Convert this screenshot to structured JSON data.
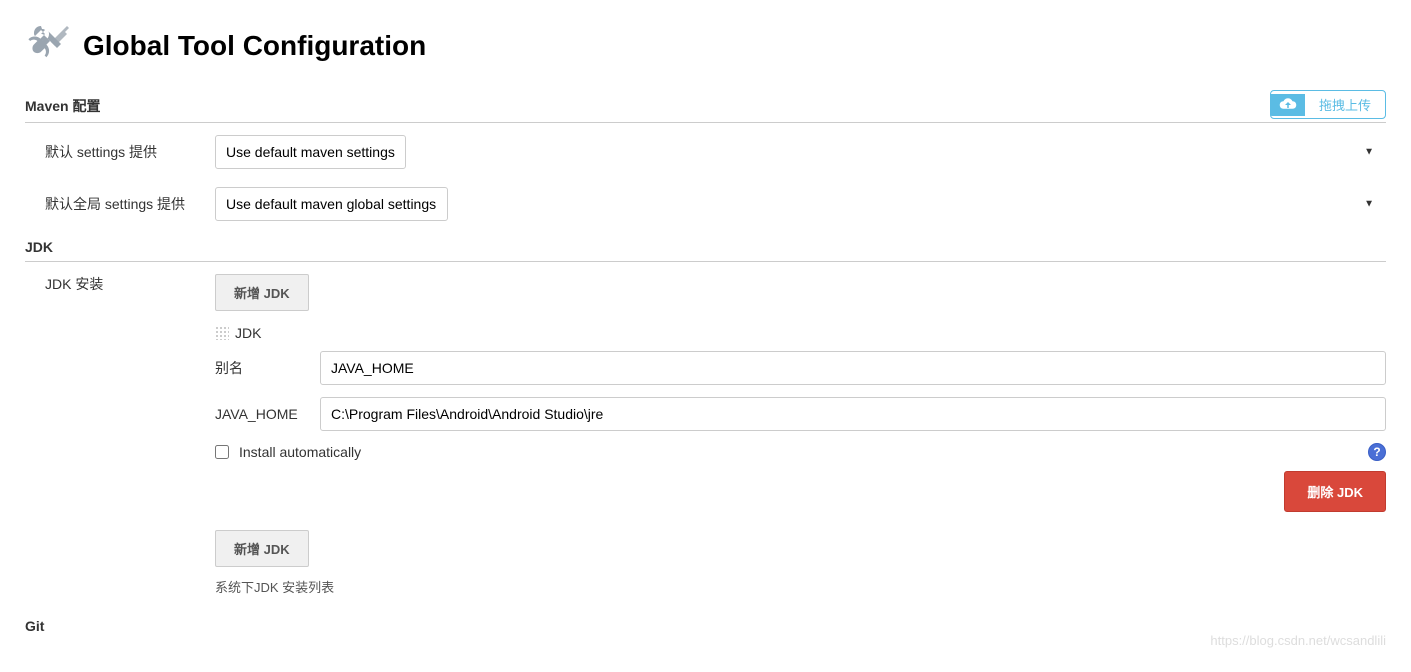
{
  "header": {
    "title": "Global Tool Configuration"
  },
  "upload_badge": {
    "text": "拖拽上传"
  },
  "maven": {
    "section_title": "Maven 配置",
    "settings_label": "默认 settings 提供",
    "settings_value": "Use default maven settings",
    "global_settings_label": "默认全局 settings 提供",
    "global_settings_value": "Use default maven global settings"
  },
  "jdk": {
    "section_title": "JDK",
    "install_label": "JDK 安装",
    "add_button": "新增 JDK",
    "block_title": "JDK",
    "alias_label": "别名",
    "alias_value": "JAVA_HOME",
    "home_label": "JAVA_HOME",
    "home_value": "C:\\Program Files\\Android\\Android Studio\\jre",
    "install_auto_label": "Install automatically",
    "install_auto_checked": false,
    "delete_button": "删除 JDK",
    "add_button2": "新增 JDK",
    "footer_text": "系统下JDK 安装列表"
  },
  "git": {
    "section_title": "Git"
  },
  "watermark": "https://blog.csdn.net/wcsandlili"
}
